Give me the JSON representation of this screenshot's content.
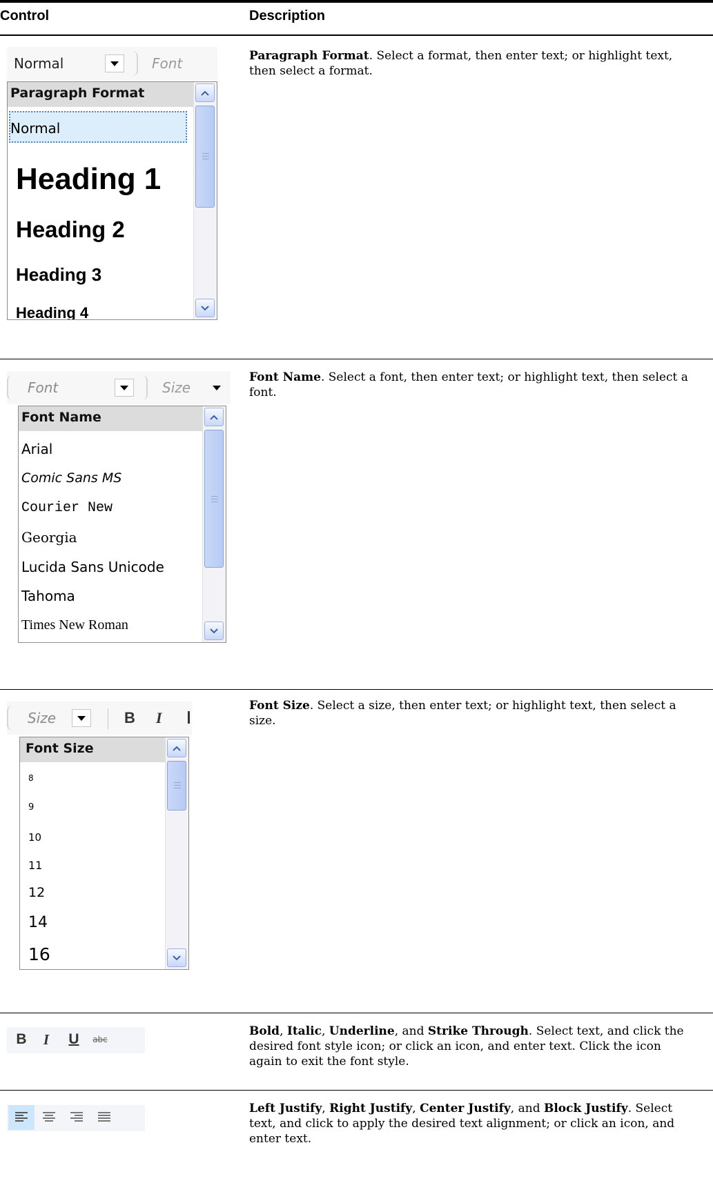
{
  "header": {
    "control": "Control",
    "description": "Description"
  },
  "paragraph": {
    "combo_value": "Normal",
    "combo_next": "Font",
    "panel_title": "Paragraph Format",
    "items": [
      "Normal",
      "Heading 1",
      "Heading 2",
      "Heading 3",
      "Heading 4"
    ],
    "desc_bold": "Paragraph Format",
    "desc_text": ". Select a format, then enter text; or highlight text, then select a format."
  },
  "fontname": {
    "combo_value": "Font",
    "combo_next": "Size",
    "panel_title": "Font Name",
    "items": [
      "Arial",
      "Comic Sans MS",
      "Courier New",
      "Georgia",
      "Lucida Sans Unicode",
      "Tahoma",
      "Times New Roman"
    ],
    "desc_bold": "Font Name",
    "desc_text": ". Select a font, then enter text; or highlight text, then select a font."
  },
  "fontsize": {
    "combo_value": "Size",
    "bold_glyph": "B",
    "italic_glyph": "I",
    "panel_title": "Font Size",
    "items": [
      "8",
      "9",
      "10",
      "11",
      "12",
      "14",
      "16"
    ],
    "desc_bold": "Font Size",
    "desc_text": ". Select a size, then enter text; or highlight text, then select a size."
  },
  "styles": {
    "bold_glyph": "B",
    "italic_glyph": "I",
    "underline_glyph": "U",
    "strike_glyph": "abc",
    "d1": "Bold",
    "s1": ", ",
    "d2": "Italic",
    "s2": ", ",
    "d3": "Underline",
    "s3": ", and ",
    "d4": "Strike Through",
    "rest": ". Select text, and click the desired font style icon; or click an icon, and enter text. Click the icon again to exit the font style."
  },
  "justify": {
    "d1": "Left Justify",
    "s1": ", ",
    "d2": "Right Justify",
    "s2": ", ",
    "d3": "Center Justify",
    "s3": ", and ",
    "d4": "Block Justify",
    "rest": ". Select text, and click to apply the desired text alignment; or click an icon, and enter text."
  },
  "colors": {
    "selection_fill": "#dcedfb",
    "selection_border": "#6f9cd9",
    "scroll_thumb": "#c4d4f6",
    "toolbar_bg": "#f4f5f9",
    "active_button": "#cde6fa"
  }
}
